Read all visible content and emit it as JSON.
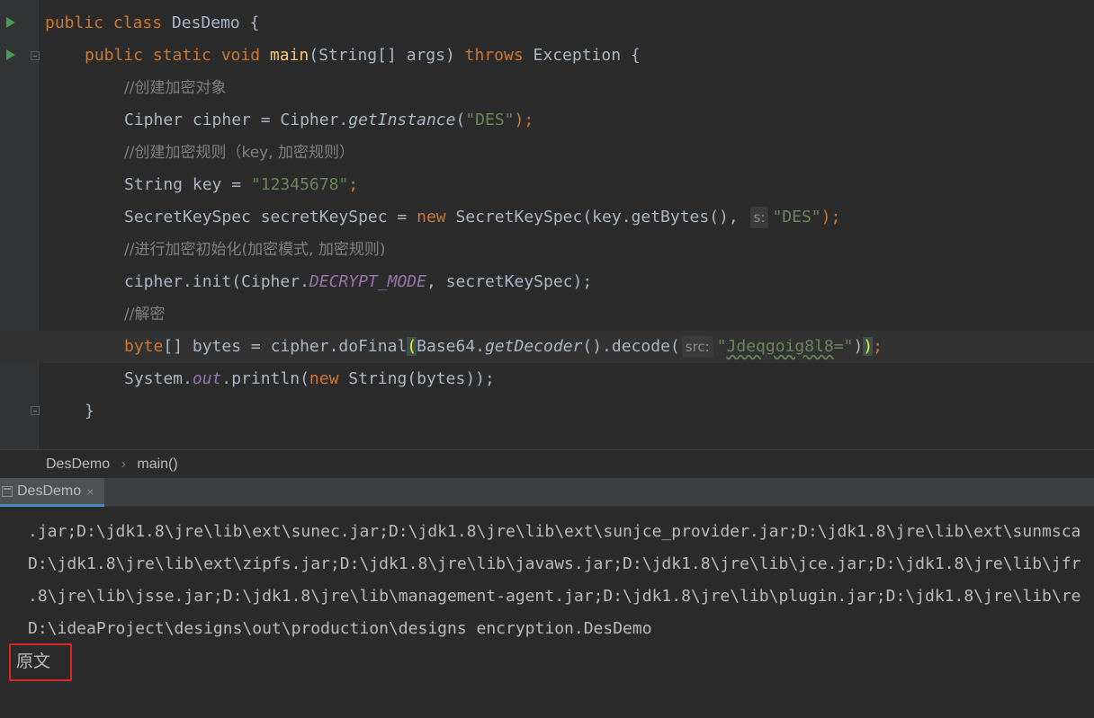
{
  "editor": {
    "lines": {
      "l1": {
        "kw1": "public class ",
        "name": "DesDemo",
        "rest": " {"
      },
      "l2": {
        "kw1": "public static void ",
        "fn": "main",
        "a": "(String[] args) ",
        "kw2": "throws",
        "b": " Exception {"
      },
      "l3": {
        "comment": "//创建加密对象"
      },
      "l4": {
        "a": "Cipher cipher = Cipher.",
        "m": "getInstance",
        "b": "(",
        "s": "\"DES\"",
        "c": ");"
      },
      "l5": {
        "comment": "//创建加密规则（key, 加密规则）"
      },
      "l6": {
        "a": "String key = ",
        "s": "\"12345678\"",
        "c": ";"
      },
      "l7": {
        "a": "SecretKeySpec secretKeySpec = ",
        "kw": "new",
        "b": " SecretKeySpec(key.getBytes(), ",
        "hint": "s:",
        "s": "\"DES\"",
        "c": ");"
      },
      "l8": {
        "comment": "//进行加密初始化(加密模式, 加密规则)"
      },
      "l9": {
        "a": "cipher.init(Cipher.",
        "k": "DECRYPT_MODE",
        "b": ", secretKeySpec);"
      },
      "l10": {
        "comment": "//解密"
      },
      "l11": {
        "kw": "byte",
        "a": "[] bytes = cipher.doFinal",
        "p1": "(",
        "b": "Base64.",
        "m": "getDecoder",
        "c": "().decode(",
        "hint": "src:",
        "s1": "\"",
        "s2": "Jdeqgoig8l8",
        "s3": "=\"",
        "d": ")",
        "p2": ")",
        "e": ";"
      },
      "l12": {
        "a": "System.",
        "out": "out",
        "b": ".println(",
        "kw": "new",
        "c": " String(bytes));"
      },
      "l13": {
        "a": "}"
      }
    }
  },
  "breadcrumb": {
    "class": "DesDemo",
    "sep": "›",
    "method": "main()"
  },
  "run_panel": {
    "tab_label": "DesDemo",
    "tab_close": "×",
    "console_lines": [
      ".jar;D:\\jdk1.8\\jre\\lib\\ext\\sunec.jar;D:\\jdk1.8\\jre\\lib\\ext\\sunjce_provider.jar;D:\\jdk1.8\\jre\\lib\\ext\\sunmsca",
      "D:\\jdk1.8\\jre\\lib\\ext\\zipfs.jar;D:\\jdk1.8\\jre\\lib\\javaws.jar;D:\\jdk1.8\\jre\\lib\\jce.jar;D:\\jdk1.8\\jre\\lib\\jfr",
      ".8\\jre\\lib\\jsse.jar;D:\\jdk1.8\\jre\\lib\\management-agent.jar;D:\\jdk1.8\\jre\\lib\\plugin.jar;D:\\jdk1.8\\jre\\lib\\re",
      "D:\\ideaProject\\designs\\out\\production\\designs encryption.DesDemo"
    ],
    "output": "原文"
  },
  "colors": {
    "keyword": "#cc7832",
    "string": "#6a8759",
    "method": "#ffc66d",
    "constant": "#9876aa",
    "highlight_box": "#e02525"
  }
}
